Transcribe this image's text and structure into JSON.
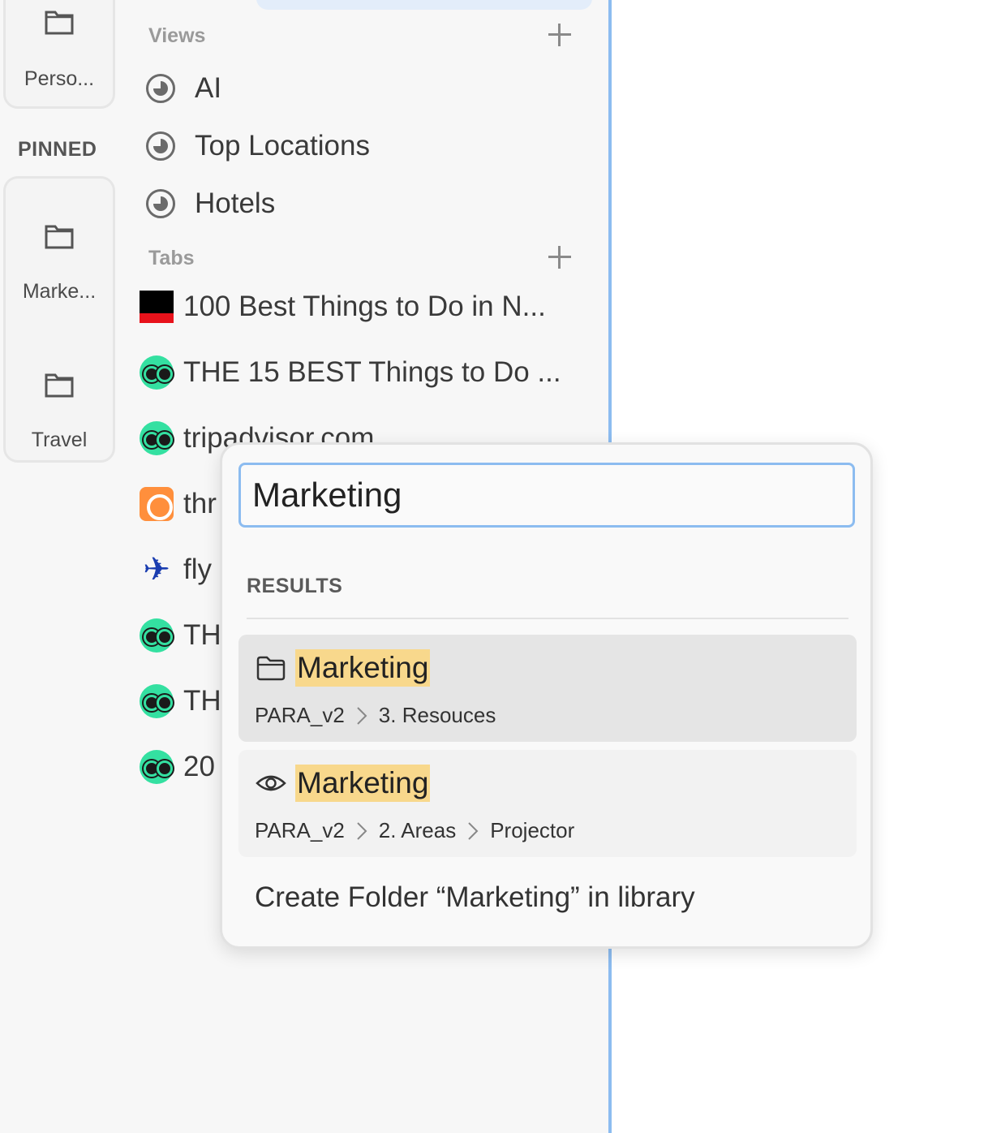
{
  "rail": {
    "top_item": "Perso...",
    "pinned_label": "PINNED",
    "pinned_items": [
      {
        "label": "Marke..."
      },
      {
        "label": "Travel"
      }
    ]
  },
  "sections": {
    "views_label": "Views",
    "tabs_label": "Tabs"
  },
  "views": [
    {
      "label": "AI",
      "icon": "view-icon"
    },
    {
      "label": "Top Locations",
      "icon": "view-icon"
    },
    {
      "label": "Hotels",
      "icon": "view-icon"
    }
  ],
  "tabs": [
    {
      "label": "100 Best Things to Do in N...",
      "icon": "nytimes-favicon"
    },
    {
      "label": "THE 15 BEST Things to Do ...",
      "icon": "tripadvisor-favicon"
    },
    {
      "label": "tripadvisor.com",
      "icon": "tripadvisor-favicon"
    },
    {
      "label": "thr",
      "icon": "orange-app-favicon"
    },
    {
      "label": "fly",
      "icon": "plane-favicon"
    },
    {
      "label": "TH",
      "icon": "tripadvisor-favicon"
    },
    {
      "label": "TH",
      "icon": "tripadvisor-favicon"
    },
    {
      "label": "20",
      "icon": "tripadvisor-favicon"
    }
  ],
  "popup": {
    "search_value": "Marketing",
    "results_label": "RESULTS",
    "results": [
      {
        "type": "folder",
        "title": "Marketing",
        "path": [
          "PARA_v2",
          "3. Resouces"
        ]
      },
      {
        "type": "view",
        "title": "Marketing",
        "path": [
          "PARA_v2",
          "2. Areas",
          "Projector"
        ]
      }
    ],
    "create_label": "Create Folder “Marketing” in library"
  },
  "colors": {
    "accent_blue": "#8cbcf0",
    "highlight": "#f8d88c",
    "tripadvisor_green": "#34e0a1"
  }
}
